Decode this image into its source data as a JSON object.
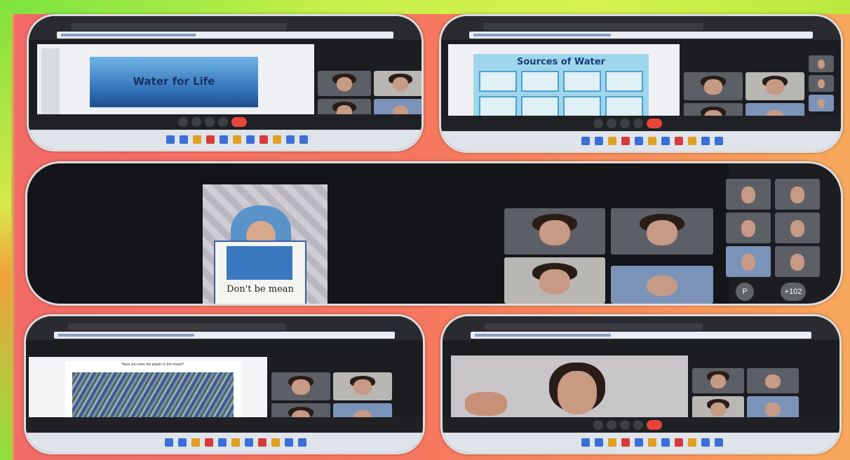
{
  "panels": [
    {
      "name": "top-left",
      "slide_title": "Water for Life"
    },
    {
      "name": "top-right",
      "slide_title": "Sources of Water"
    },
    {
      "name": "middle",
      "poster_text": "Don't be mean"
    },
    {
      "name": "bottom-left",
      "slide_caption": "Have you seen the plastic in the ocean?"
    },
    {
      "name": "bottom-right"
    }
  ],
  "controls": {
    "avatar_initial": "P",
    "more_participants": "+102"
  }
}
